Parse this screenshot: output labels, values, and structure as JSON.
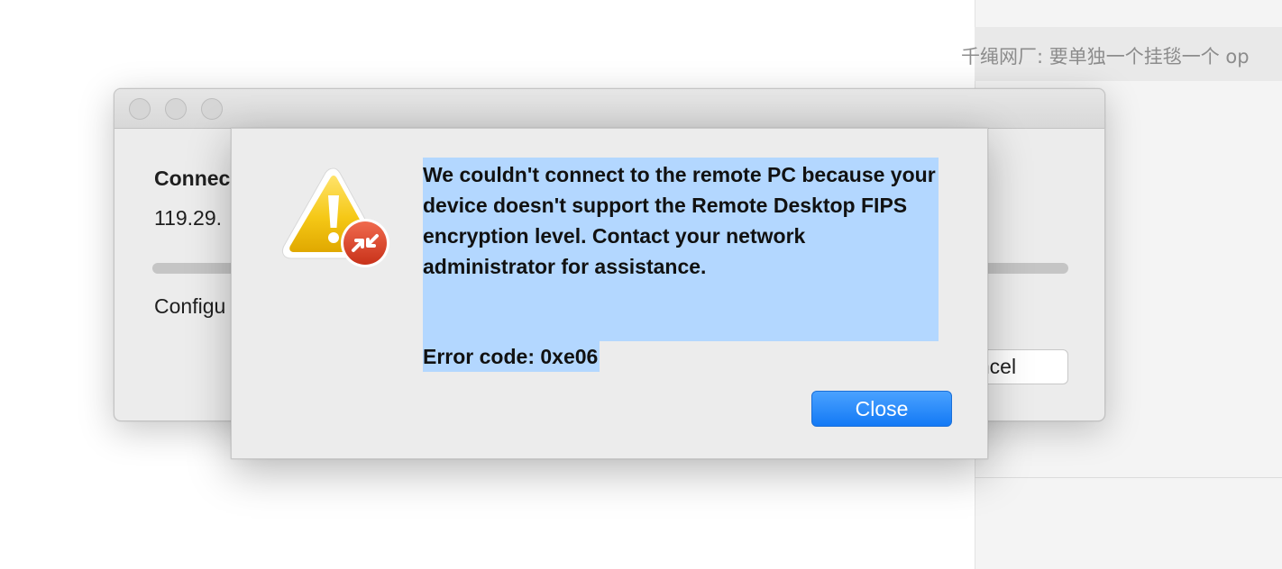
{
  "background": {
    "chat_preview_text": "千绳网厂: 要单独一个挂毯一个 op"
  },
  "connect_window": {
    "title": "Connec",
    "address": "119.29.",
    "status": "Configu",
    "cancel_label": "ncel"
  },
  "alert": {
    "message": "We couldn't connect to the remote PC because your device doesn't support the Remote Desktop FIPS encryption level. Contact your network administrator for assistance.",
    "error_code": "Error code: 0xe06",
    "close_label": "Close",
    "icon": "warning-remote-desktop-icon"
  },
  "colors": {
    "selection": "#b3d7ff",
    "primary_button": "#1a7cf6",
    "warning": "#f2c511",
    "badge": "#e04a2d"
  }
}
